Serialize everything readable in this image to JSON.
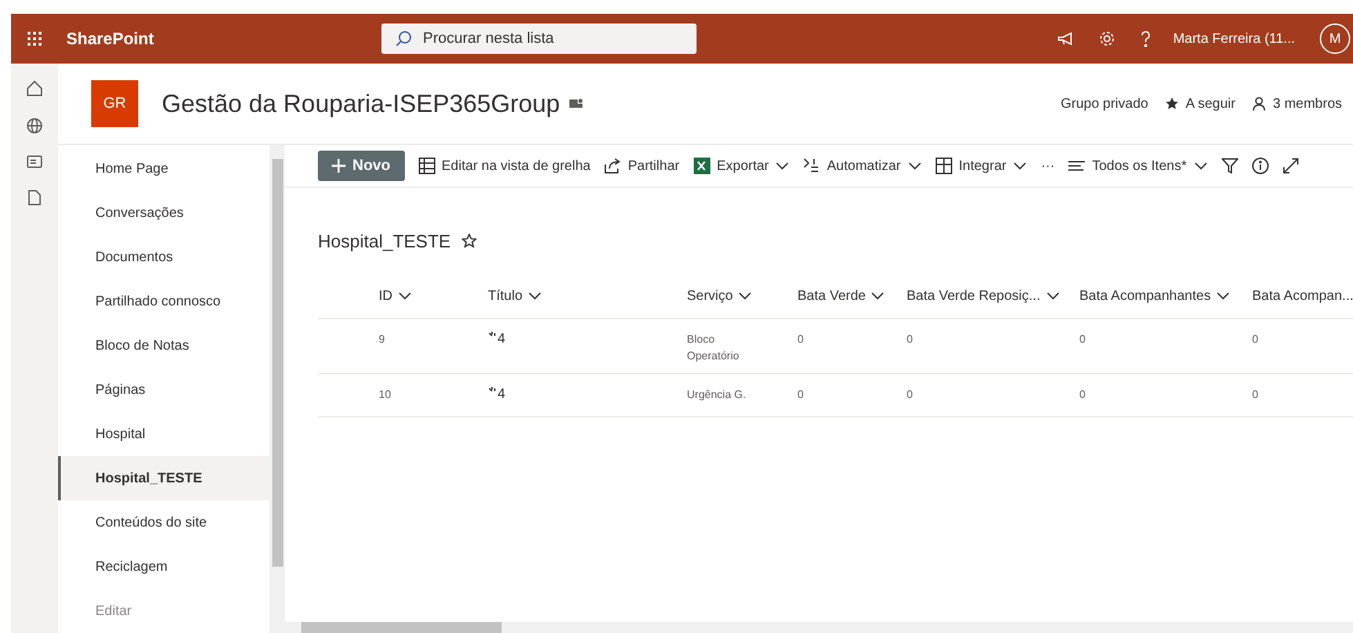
{
  "suite_bar": {
    "app_name": "SharePoint",
    "search": {
      "placeholder": "Procurar nesta lista"
    },
    "user_name": "Marta Ferreira (11...",
    "avatar": "M"
  },
  "site": {
    "logo": "GR",
    "title": "Gestão da Rouparia-ISEP365Group",
    "privacy": "Grupo privado",
    "follow": "A seguir",
    "members": "3 membros"
  },
  "nav": [
    {
      "label": "Home Page",
      "selected": false,
      "kind": "link"
    },
    {
      "label": "Conversações",
      "selected": false,
      "kind": "link"
    },
    {
      "label": "Documentos",
      "selected": false,
      "kind": "link"
    },
    {
      "label": "Partilhado connosco",
      "selected": false,
      "kind": "link"
    },
    {
      "label": "Bloco de Notas",
      "selected": false,
      "kind": "link"
    },
    {
      "label": "Páginas",
      "selected": false,
      "kind": "link"
    },
    {
      "label": "Hospital",
      "selected": false,
      "kind": "link"
    },
    {
      "label": "Hospital_TESTE",
      "selected": true,
      "kind": "link"
    },
    {
      "label": "Conteúdos do site",
      "selected": false,
      "kind": "link"
    },
    {
      "label": "Reciclagem",
      "selected": false,
      "kind": "link"
    },
    {
      "label": "Editar",
      "selected": false,
      "kind": "edit"
    }
  ],
  "command_bar": {
    "new_button": "Novo",
    "commands": [
      {
        "label": "Editar na vista de grelha",
        "kind": "grid",
        "dropdown": false
      },
      {
        "label": "Partilhar",
        "kind": "share",
        "dropdown": false
      },
      {
        "label": "Exportar",
        "kind": "excel",
        "dropdown": true
      },
      {
        "label": "Automatizar",
        "kind": "flow",
        "dropdown": true
      },
      {
        "label": "Integrar",
        "kind": "integrate",
        "dropdown": true
      }
    ],
    "more": "···",
    "view": "Todos os Itens*"
  },
  "list": {
    "title": "Hospital_TESTE",
    "columns": [
      "ID",
      "Título",
      "Serviço",
      "Bata Verde",
      "Bata Verde Reposiç...",
      "Bata Acompanhantes",
      "Bata Acompan..."
    ],
    "rows": [
      {
        "cells": [
          "9",
          "4",
          "Bloco Operatório",
          "0",
          "0",
          "0",
          "0"
        ],
        "is_new": true
      },
      {
        "cells": [
          "10",
          "4",
          "Urgência G.",
          "0",
          "0",
          "0",
          "0"
        ],
        "is_new": true
      }
    ]
  }
}
